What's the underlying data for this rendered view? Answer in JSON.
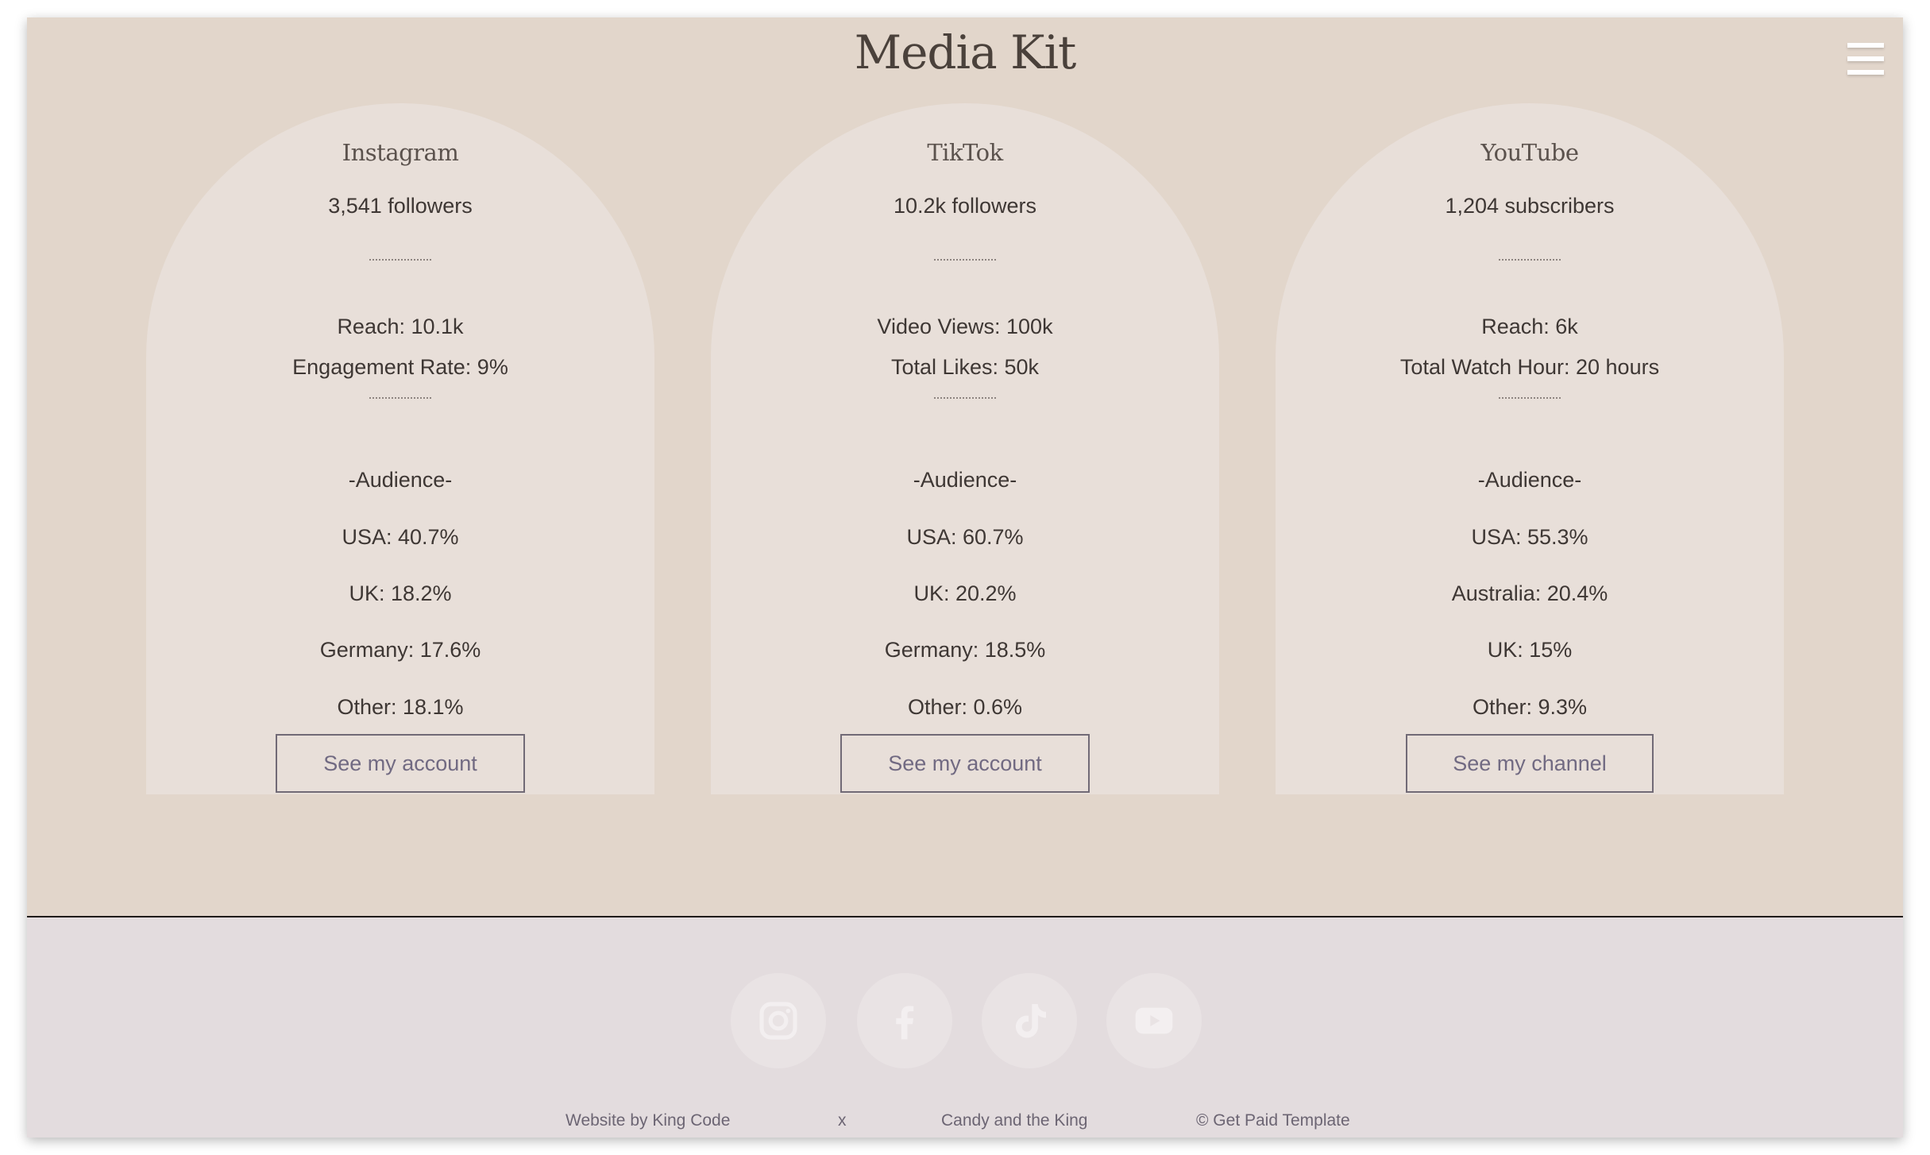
{
  "header": {
    "title": "Media Kit",
    "menu_icon": "hamburger-menu-icon"
  },
  "platforms": [
    {
      "name": "Instagram",
      "followers": "3,541 followers",
      "stat1": "Reach: 10.1k",
      "stat2": "Engagement Rate: 9%",
      "audience_heading": "-Audience-",
      "audience": [
        "USA: 40.7%",
        "UK: 18.2%",
        "Germany: 17.6%",
        "Other: 18.1%"
      ],
      "button": "See my account"
    },
    {
      "name": "TikTok",
      "followers": "10.2k followers",
      "stat1": "Video Views: 100k",
      "stat2": "Total Likes: 50k",
      "audience_heading": "-Audience-",
      "audience": [
        "USA: 60.7%",
        "UK: 20.2%",
        "Germany: 18.5%",
        "Other: 0.6%"
      ],
      "button": "See my account"
    },
    {
      "name": "YouTube",
      "followers": "1,204 subscribers",
      "stat1": "Reach: 6k",
      "stat2": "Total Watch Hour: 20 hours",
      "audience_heading": "-Audience-",
      "audience": [
        "USA: 55.3%",
        "Australia: 20.4%",
        "UK: 15%",
        "Other: 9.3%"
      ],
      "button": "See my channel"
    }
  ],
  "footer": {
    "social_icons": [
      "instagram-icon",
      "facebook-icon",
      "tiktok-icon",
      "youtube-icon"
    ],
    "credit_website": "Website by King Code",
    "credit_x": "x",
    "credit_partner": "Candy and the King",
    "credit_template": "© Get Paid Template"
  },
  "colors": {
    "page_background": "#e2d6cb",
    "card_background": "#e8dfd9",
    "footer_background": "#e3dcde",
    "social_circle": "#e9e3e4",
    "button_text": "#716a82"
  }
}
